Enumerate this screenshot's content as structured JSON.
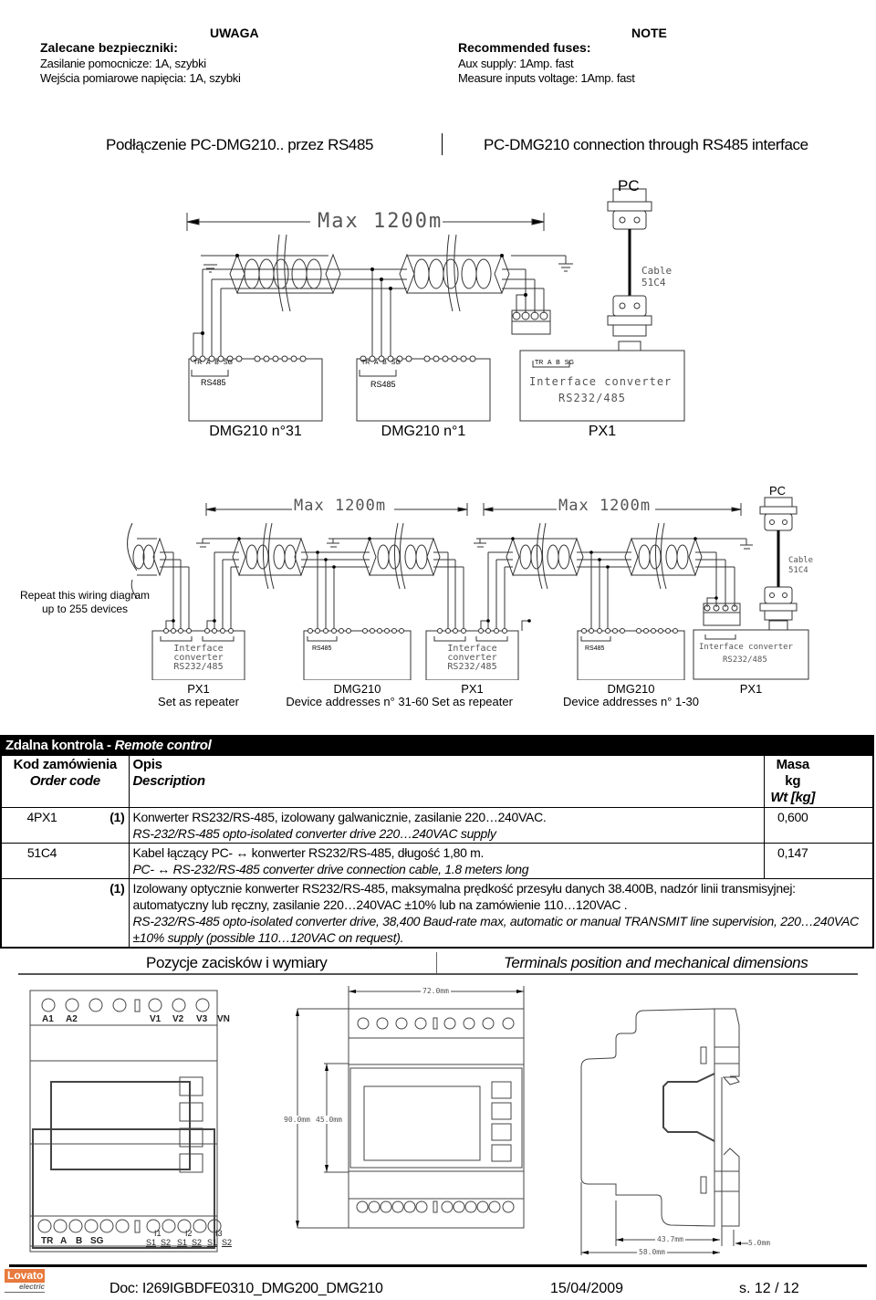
{
  "notes": {
    "pl": {
      "title": "UWAGA",
      "heading": "Zalecane bezpieczniki:",
      "lines": [
        "Zasilanie pomocnicze: 1A, szybki",
        "Wejścia pomiarowe napięcia: 1A, szybki"
      ]
    },
    "en": {
      "title": "NOTE",
      "heading": "Recommended fuses:",
      "lines": [
        "Aux supply: 1Amp. fast",
        "Measure inputs voltage: 1Amp. fast"
      ]
    }
  },
  "section1": {
    "title_pl": "Podłączenie PC-DMG210.. przez RS485",
    "title_en": "PC-DMG210 connection through RS485 interface"
  },
  "diagram1": {
    "pc_label": "PC",
    "max_label": "Max 1200m",
    "cable_label": [
      "Cable",
      "51C4"
    ],
    "terminals": [
      "TR",
      "A",
      "B",
      "SG"
    ],
    "rs485_label": "RS485",
    "converter_label": [
      "Interface converter",
      "RS232/485"
    ],
    "devices": [
      "DMG210 n°31",
      "DMG210 n°1",
      "PX1"
    ]
  },
  "diagram2": {
    "pc_label": "PC",
    "max_label": "Max 1200m",
    "cable_label": [
      "Cable",
      "51C4"
    ],
    "repeat_note": [
      "Repeat this wiring diagram",
      "up to 255 devices"
    ],
    "converter_label_stacked": [
      "Interface",
      "converter",
      "RS232/485"
    ],
    "converter_label": [
      "Interface converter",
      "RS232/485"
    ],
    "rs485_label": "RS485",
    "devices": [
      {
        "name": "PX1",
        "sub": "Set as repeater"
      },
      {
        "name": "DMG210",
        "sub": "Device addresses n° 31-60"
      },
      {
        "name": "PX1",
        "sub": "Set as repeater"
      },
      {
        "name": "DMG210",
        "sub": "Device addresses n° 1-30"
      },
      {
        "name": "PX1",
        "sub": ""
      }
    ]
  },
  "table": {
    "title_pl": "Zdalna kontrola - ",
    "title_en": "Remote control",
    "headers": {
      "code_pl": "Kod zamówienia",
      "code_en": "Order code",
      "desc_pl": "Opis",
      "desc_en": "Description",
      "mass_pl": "Masa kg",
      "mass_en": "Wt [kg]"
    },
    "rows": [
      {
        "code": "4PX1",
        "note": "(1)",
        "desc_pl": "Konwerter RS232/RS-485, izolowany galwanicznie, zasilanie 220…240VAC.",
        "desc_en": "RS-232/RS-485 opto-isolated converter drive 220…240VAC supply",
        "mass": "0,600"
      },
      {
        "code": "51C4",
        "note": "",
        "desc_pl": "Kabel łączący PC- ↔ konwerter RS232/RS-485, długość 1,80 m.",
        "desc_en": "PC- ↔ RS-232/RS-485 converter drive connection cable, 1.8 meters long",
        "mass": "0,147"
      }
    ],
    "footnote": {
      "marker": "(1)",
      "pl_1": "Izolowany optycznie konwerter RS232/RS-485, maksymalna prędkość przesyłu danych 38.400B, nadzór linii transmisyjnej:",
      "pl_2": "automatyczny lub ręczny, zasilanie 220…240VAC ±10% lub na zamówienie 110…120VAC .",
      "en_1": "RS-232/RS-485 opto-isolated converter drive, 38,400 Baud-rate max, automatic or manual TRANSMIT line supervision, 220…240VAC",
      "en_2": "±10% supply (possible 110…120VAC on request)."
    }
  },
  "section2": {
    "title_pl": "Pozycje zacisków i wymiary",
    "title_en": "Terminals position and  mechanical dimensions"
  },
  "dimensions": {
    "top_terminals": [
      "A1",
      "A2",
      "V1",
      "V2",
      "V3",
      "VN"
    ],
    "bottom_terminals": [
      "TR",
      "A",
      "B",
      "SG"
    ],
    "current_groups": [
      "I1",
      "I2",
      "I3"
    ],
    "current_terms": [
      "S1",
      "S2",
      "S1",
      "S2",
      "S1",
      "S2"
    ],
    "width": "72.0mm",
    "height": "90.0mm",
    "front_height": "45.0mm",
    "depth_a": "43.7mm",
    "depth_b": "58.0mm",
    "rail": "5.0mm"
  },
  "footer": {
    "logo_top": "Lovato",
    "logo_bottom": "electric",
    "doc": "Doc: I269IGBDFE0310_DMG200_DMG210",
    "date": "15/04/2009",
    "page": "s. 12 / 12"
  }
}
